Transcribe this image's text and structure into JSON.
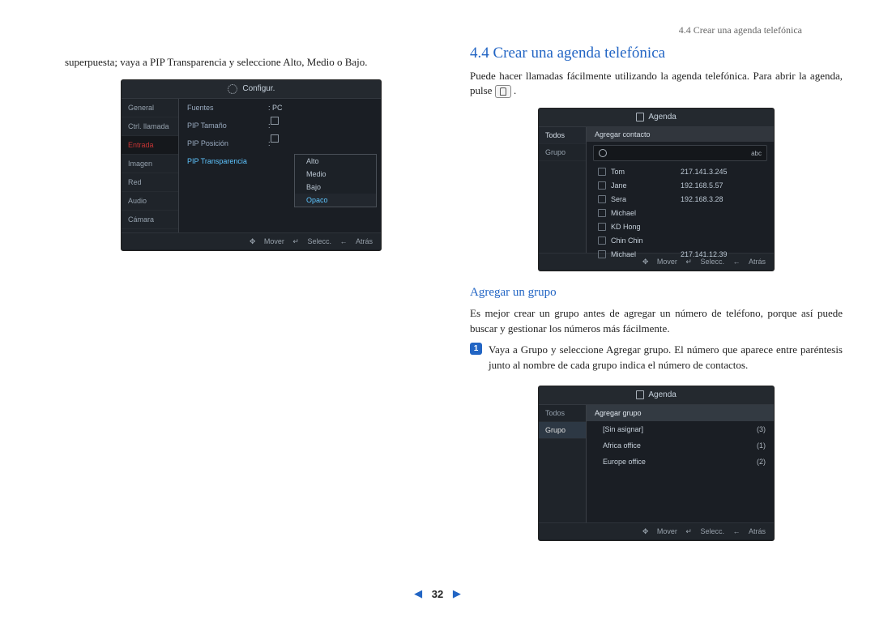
{
  "header": {
    "crumb": "4.4 Crear una agenda telefónica"
  },
  "colLeft": {
    "intro": "superpuesta; vaya a PIP Transparencia y seleccione Alto, Medio o Bajo.",
    "config": {
      "title": "Configur.",
      "side": [
        "General",
        "Ctrl. llamada",
        "Entrada",
        "Imagen",
        "Red",
        "Audio",
        "Cámara"
      ],
      "selectedSide": "Entrada",
      "rows": [
        {
          "label": "Fuentes",
          "val": ": PC"
        },
        {
          "label": "PIP Tamaño",
          "val": ":"
        },
        {
          "label": "PIP Posición",
          "val": ":"
        },
        {
          "label": "PIP Transparencia",
          "val": ""
        }
      ],
      "popup": [
        "Alto",
        "Medio",
        "Bajo",
        "Opaco"
      ],
      "popupSel": "Opaco",
      "footer": {
        "move": "Mover",
        "select": "Selecc.",
        "back": "Atrás"
      }
    }
  },
  "colRight": {
    "h2": "4.4   Crear una agenda telefónica",
    "p1a": "Puede hacer llamadas fácilmente utilizando la agenda telefónica. Para abrir la agenda, pulse ",
    "p1b": ".",
    "agenda1": {
      "title": "Agenda",
      "side": [
        "Todos",
        "Grupo"
      ],
      "addbar": "Agregar contacto",
      "abc": "abc",
      "contacts": [
        {
          "name": "Tom",
          "ip": "217.141.3.245"
        },
        {
          "name": "Jane",
          "ip": "192.168.5.57"
        },
        {
          "name": "Sera",
          "ip": "192.168.3.28"
        },
        {
          "name": "Michael",
          "ip": ""
        },
        {
          "name": "KD Hong",
          "ip": ""
        },
        {
          "name": "Chin Chin",
          "ip": ""
        },
        {
          "name": "Michael",
          "ip": "217.141.12.39"
        }
      ],
      "footer": {
        "move": "Mover",
        "select": "Selecc.",
        "back": "Atrás"
      }
    },
    "h3": "Agregar un grupo",
    "p2": "Es mejor crear un grupo antes de agregar un número de teléfono, porque así puede buscar y gestionar los números más fácilmente.",
    "step1num": "1",
    "step1": "Vaya a Grupo y seleccione Agregar grupo. El número que aparece entre paréntesis junto al nombre de cada grupo indica el número de contactos.",
    "agenda2": {
      "title": "Agenda",
      "side": [
        "Todos",
        "Grupo"
      ],
      "sideSel": "Grupo",
      "head": "Agregar grupo",
      "groups": [
        {
          "name": "[Sin asignar]",
          "count": "(3)"
        },
        {
          "name": "Africa office",
          "count": "(1)"
        },
        {
          "name": "Europe office",
          "count": "(2)"
        }
      ],
      "footer": {
        "move": "Mover",
        "select": "Selecc.",
        "back": "Atrás"
      }
    }
  },
  "page": {
    "num": "32"
  }
}
